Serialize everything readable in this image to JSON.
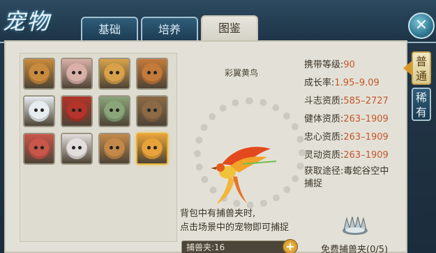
{
  "header": {
    "title": "宠物",
    "tabs": [
      {
        "label": "基础",
        "active": false
      },
      {
        "label": "培养",
        "active": false
      },
      {
        "label": "图鉴",
        "active": true
      }
    ],
    "close_label": "✕"
  },
  "side_tabs": [
    {
      "label": "普通",
      "active": true
    },
    {
      "label": "稀有",
      "active": false
    }
  ],
  "pets": [
    {
      "icon": "monkey-portrait",
      "color": "#c88a3c"
    },
    {
      "icon": "rabbit-portrait",
      "color": "#d9b0a8"
    },
    {
      "icon": "girl-flower-portrait",
      "color": "#d8a24a"
    },
    {
      "icon": "dog-portrait",
      "color": "#c47a3a"
    },
    {
      "icon": "white-bear-portrait",
      "color": "#e6ecef"
    },
    {
      "icon": "red-bird-portrait",
      "color": "#b2342a"
    },
    {
      "icon": "green-spirit-portrait",
      "color": "#8aa57a"
    },
    {
      "icon": "owl-portrait",
      "color": "#8c6a45"
    },
    {
      "icon": "girl-portrait",
      "color": "#c9564a"
    },
    {
      "icon": "white-fox-portrait",
      "color": "#e3dedc"
    },
    {
      "icon": "deer-portrait",
      "color": "#c4894a"
    },
    {
      "icon": "phoenix-portrait",
      "color": "#e7a23a"
    }
  ],
  "selected_pet_index": 11,
  "detail": {
    "name": "彩翼黄鸟",
    "stats": [
      {
        "label": "携带等级:",
        "value": "90"
      },
      {
        "label": "成长率:",
        "value": "1.95–9.09"
      },
      {
        "label": "斗志资质:",
        "value": "585–2727"
      },
      {
        "label": "健体资质:",
        "value": "263–1909"
      },
      {
        "label": "忠心资质:",
        "value": "263–1909"
      },
      {
        "label": "灵动资质:",
        "value": "263–1909"
      }
    ],
    "obtain_label": "获取途径:",
    "obtain_value": "毒蛇谷空中捕捉"
  },
  "hint": {
    "line1": "背包中有捕兽夹时,",
    "line2": "点击场景中的宠物即可捕捉"
  },
  "trap": {
    "label": "捕兽夹:16",
    "plus": "+",
    "free_label": "免费捕兽夹(0/5)"
  }
}
